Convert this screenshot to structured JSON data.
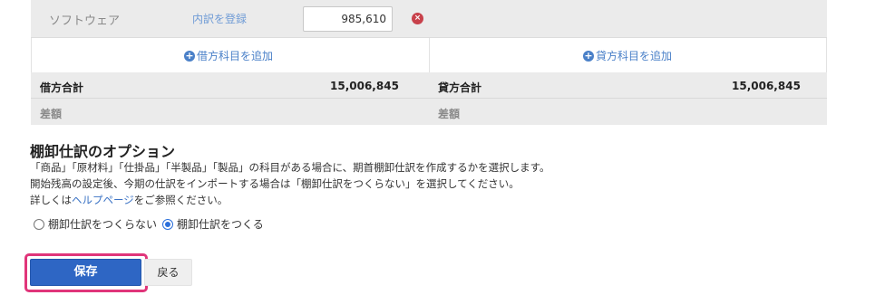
{
  "journal_table": {
    "software_row": {
      "label": "ソフトウェア",
      "register_link": "内訳を登録",
      "amount": "985,610",
      "delete_icon": "x-circle-icon"
    },
    "add_debit": "借方科目を追加",
    "add_credit": "貸方科目を追加",
    "totals": {
      "debit_label": "借方合計",
      "debit_value": "15,006,845",
      "credit_label": "貸方合計",
      "credit_value": "15,006,845"
    },
    "difference": {
      "debit_label": "差額",
      "credit_label": "差額"
    }
  },
  "inventory_option": {
    "title": "棚卸仕訳のオプション",
    "desc1": "「商品」「原材料」「仕掛品」「半製品」「製品」の科目がある場合に、期首棚卸仕訳を作成するかを選択します。",
    "desc2": "開始残高の設定後、今期の仕訳をインポートする場合は「棚卸仕訳をつくらない」を選択してください。",
    "desc3_prefix": "詳しくは",
    "desc3_link": "ヘルプページ",
    "desc3_suffix": "をご参照ください。",
    "radio_no": "棚卸仕訳をつくらない",
    "radio_yes": "棚卸仕訳をつくる",
    "selected": "棚卸仕訳をつくる"
  },
  "actions": {
    "save": "保存",
    "back": "戻る"
  },
  "colors": {
    "primary": "#2e66c4",
    "highlight": "#e0357a",
    "link": "#4a80c8",
    "delete": "#c8414b"
  }
}
